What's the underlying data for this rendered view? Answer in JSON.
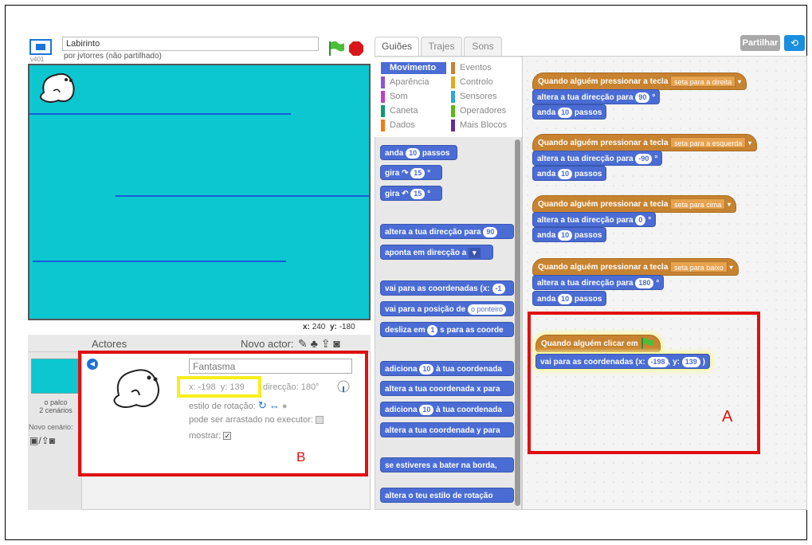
{
  "project": {
    "title": "Labirinto",
    "byline": "por jvtorres (não partilhado)",
    "version": "v401"
  },
  "stage": {
    "mouse_x_label": "x:",
    "mouse_x": "240",
    "mouse_y_label": "y:",
    "mouse_y": "-180"
  },
  "sprites_pane": {
    "actors_label": "Actores",
    "new_actor_label": "Novo actor:",
    "stage_label": "o palco",
    "stage_scenes": "2 cenários",
    "new_scene_label": "Novo cenário:"
  },
  "sprite_info": {
    "name": "Fantasma",
    "x_label": "x:",
    "x": "-198",
    "y_label": "y:",
    "y": "139",
    "direction_label": "direcção:",
    "direction": "180°",
    "rotation_style_label": "estilo de rotação:",
    "draggable_label": "pode ser arrastado no executor:",
    "show_label": "mostrar:"
  },
  "tabs": [
    "Guiões",
    "Trajes",
    "Sons"
  ],
  "share_label": "Partilhar",
  "categories": [
    {
      "label": "Movimento",
      "color": "#4a6cd4"
    },
    {
      "label": "Eventos",
      "color": "#c88330"
    },
    {
      "label": "Aparência",
      "color": "#8a55d7"
    },
    {
      "label": "Controlo",
      "color": "#e1a91a"
    },
    {
      "label": "Som",
      "color": "#bb42c3"
    },
    {
      "label": "Sensores",
      "color": "#2ca5e2"
    },
    {
      "label": "Caneta",
      "color": "#0e9a6c"
    },
    {
      "label": "Operadores",
      "color": "#5cb712"
    },
    {
      "label": "Dados",
      "color": "#ee7d16"
    },
    {
      "label": "Mais Blocos",
      "color": "#632d99"
    }
  ],
  "palette_blocks": {
    "move_a": "anda",
    "move_n": "10",
    "move_b": "passos",
    "turn_right_a": "gira",
    "turn_right_n": "15",
    "turn_right_b": "°",
    "turn_left_a": "gira",
    "turn_left_n": "15",
    "turn_left_b": "°",
    "point_dir_a": "altera a tua direcção para",
    "point_dir_n": "90",
    "point_towards": "aponta em direcção a",
    "goto_xy": "vai para as coordenadas (x:",
    "goto_xy_n": "-1",
    "goto_target_a": "vai para a posição de",
    "goto_target_drop": "o ponteiro",
    "glide_a": "desliza em",
    "glide_n": "1",
    "glide_b": "s para as coorde",
    "change_x_a": "adiciona",
    "change_x_n": "10",
    "change_x_b": "à tua coordenada",
    "set_x": "altera a tua coordenada x para",
    "change_y_a": "adiciona",
    "change_y_n": "10",
    "change_y_b": "à tua coordenada",
    "set_y": "altera a tua coordenada y para",
    "bounce": "se estiveres a bater na borda,",
    "rot_style": "altera o teu estilo de rotação"
  },
  "scripts": [
    {
      "hat": "Quando alguém pressionar a tecla",
      "key": "seta para a direita",
      "dir_label": "altera a tua direcção para",
      "dir": "90",
      "deg": "°",
      "move_a": "anda",
      "move_n": "10",
      "move_b": "passos"
    },
    {
      "hat": "Quando alguém pressionar a tecla",
      "key": "seta para a esquerda",
      "dir_label": "altera a tua direcção para",
      "dir": "-90",
      "deg": "°",
      "move_a": "anda",
      "move_n": "10",
      "move_b": "passos"
    },
    {
      "hat": "Quando alguém pressionar a tecla",
      "key": "seta para cima",
      "dir_label": "altera a tua direcção para",
      "dir": "0",
      "deg": "°",
      "move_a": "anda",
      "move_n": "10",
      "move_b": "passos"
    },
    {
      "hat": "Quando alguém pressionar a tecla",
      "key": "seta para baixo",
      "dir_label": "altera a tua direcção para",
      "dir": "180",
      "deg": "°",
      "move_a": "anda",
      "move_n": "10",
      "move_b": "passos"
    }
  ],
  "flag_script": {
    "hat": "Quando alguém clicar em",
    "goto_a": "vai para as coordenadas (x:",
    "x": "-198",
    "sep": ", y:",
    "y": "139",
    "close": ")"
  },
  "annotations": {
    "a": "A",
    "b": "B"
  },
  "colors": {
    "stage_bg": "#0cc7cf",
    "highlight_red": "#e01010",
    "highlight_yellow": "#f7ee1b",
    "motion": "#4a6cd4",
    "events": "#c88330"
  }
}
